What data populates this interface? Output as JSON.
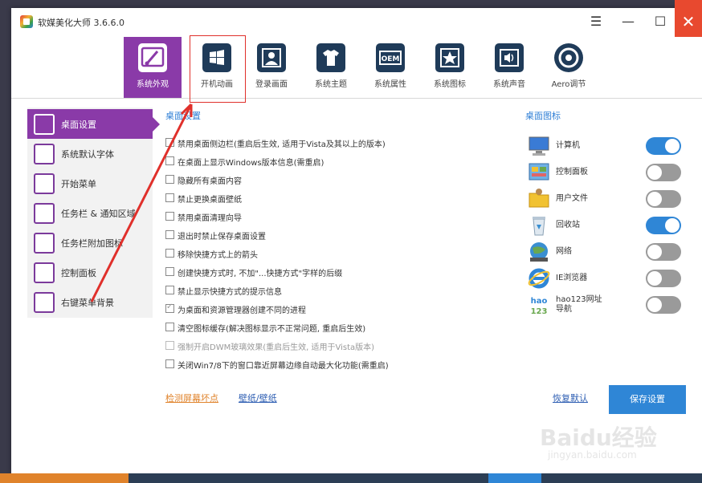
{
  "app": {
    "title": "软媒美化大师 3.6.6.0"
  },
  "window_controls": {
    "menu": "☰",
    "minimize": "—",
    "maximize": "☐",
    "close": "✕"
  },
  "toolbar": [
    {
      "label": "系统外观",
      "icon": "brush-icon",
      "active": true
    },
    {
      "label": "开机动画",
      "icon": "windows-logo-icon",
      "active": false
    },
    {
      "label": "登录画面",
      "icon": "user-portrait-icon",
      "active": false
    },
    {
      "label": "系统主题",
      "icon": "tshirt-icon",
      "active": false
    },
    {
      "label": "系统属性",
      "icon": "oem-icon",
      "active": false
    },
    {
      "label": "系统图标",
      "icon": "star-icon",
      "active": false
    },
    {
      "label": "系统声音",
      "icon": "speaker-icon",
      "active": false
    },
    {
      "label": "Aero调节",
      "icon": "aero-icon",
      "active": false
    }
  ],
  "oem_text": "OEM",
  "sidebar": [
    {
      "label": "桌面设置",
      "icon": "wrench-icon",
      "active": true
    },
    {
      "label": "系统默认字体",
      "icon": "font-icon",
      "active": false
    },
    {
      "label": "开始菜单",
      "icon": "start-menu-icon",
      "active": false
    },
    {
      "label": "任务栏 & 通知区域",
      "icon": "taskbar-icon",
      "active": false
    },
    {
      "label": "任务栏附加图标",
      "icon": "taskbar-extra-icon",
      "active": false
    },
    {
      "label": "控制面板",
      "icon": "control-panel-icon",
      "active": false
    },
    {
      "label": "右键菜单背景",
      "icon": "context-menu-icon",
      "active": false
    }
  ],
  "desktop_settings": {
    "title": "桌面设置",
    "options": [
      {
        "label": "禁用桌面侧边栏(重启后生效, 适用于Vista及其以上的版本)",
        "checked": false,
        "disabled": false
      },
      {
        "label": "在桌面上显示Windows版本信息(需重启)",
        "checked": false,
        "disabled": false
      },
      {
        "label": "隐藏所有桌面内容",
        "checked": false,
        "disabled": false
      },
      {
        "label": "禁止更换桌面壁纸",
        "checked": false,
        "disabled": false
      },
      {
        "label": "禁用桌面清理向导",
        "checked": false,
        "disabled": false
      },
      {
        "label": "退出时禁止保存桌面设置",
        "checked": false,
        "disabled": false
      },
      {
        "label": "移除快捷方式上的箭头",
        "checked": false,
        "disabled": false
      },
      {
        "label": "创建快捷方式时, 不加\"...快捷方式\"字样的后缀",
        "checked": false,
        "disabled": false
      },
      {
        "label": "禁止显示快捷方式的提示信息",
        "checked": false,
        "disabled": false
      },
      {
        "label": "为桌面和资源管理器创建不同的进程",
        "checked": true,
        "disabled": false
      },
      {
        "label": "清空图标缓存(解决图标显示不正常问题, 重启后生效)",
        "checked": false,
        "disabled": false
      },
      {
        "label": "强制开启DWM玻璃效果(重启后生效, 适用于Vista版本)",
        "checked": false,
        "disabled": true
      },
      {
        "label": "关闭Win7/8下的窗口靠近屏幕边缘自动最大化功能(需重启)",
        "checked": false,
        "disabled": false
      }
    ]
  },
  "desktop_icons": {
    "title": "桌面图标",
    "items": [
      {
        "label": "计算机",
        "icon": "computer-icon",
        "on": true
      },
      {
        "label": "控制面板",
        "icon": "control-panel-desktop-icon",
        "on": false
      },
      {
        "label": "用户文件",
        "icon": "user-folder-icon",
        "on": false
      },
      {
        "label": "回收站",
        "icon": "recycle-bin-icon",
        "on": true
      },
      {
        "label": "网络",
        "icon": "network-icon",
        "on": false
      },
      {
        "label": "IE浏览器",
        "icon": "ie-icon",
        "on": false
      },
      {
        "label": "hao123网址导航",
        "icon": "hao123-icon",
        "on": false
      }
    ]
  },
  "hao123_logo_text": {
    "top": "hao",
    "bottom": "123"
  },
  "footer": {
    "link_check": "检测屏幕坏点",
    "link_wallpaper": "壁纸/壁纸",
    "link_restore": "恢复默认",
    "save_label": "保存设置"
  },
  "watermark": {
    "brand": "Baidu经验",
    "url": "jingyan.baidu.com"
  },
  "colors": {
    "accent_purple": "#8a3aa8",
    "accent_blue": "#2f86d6",
    "link_orange": "#e0832b",
    "annotation_red": "#e0302b",
    "close_red": "#e8492f"
  }
}
